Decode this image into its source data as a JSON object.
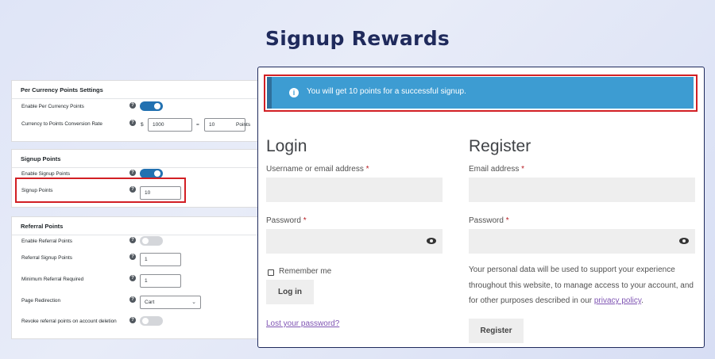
{
  "headline": "Signup Rewards",
  "admin": {
    "currency_section": {
      "title": "Per Currency Points Settings",
      "enable_label": "Enable Per Currency Points",
      "enable_state": "on",
      "conversion_label": "Currency to Points Conversion Rate",
      "currency_symbol": "$",
      "currency_value": "1000",
      "equals_sign": "=",
      "points_value": "10",
      "points_suffix": "Points"
    },
    "signup_section": {
      "title": "Signup Points",
      "enable_label": "Enable Signup Points",
      "enable_state": "on",
      "points_label": "Signup Points",
      "points_value": "10"
    },
    "referral_section": {
      "title": "Referral Points",
      "enable_label": "Enable Referral Points",
      "enable_state": "off",
      "signup_points_label": "Referral Signup Points",
      "signup_points_value": "1",
      "min_required_label": "Minimum Referral Required",
      "min_required_value": "1",
      "redirect_label": "Page Redirection",
      "redirect_value": "Cart",
      "revoke_label": "Revoke referral points on account deletion",
      "revoke_state": "off"
    },
    "help_glyph": "?"
  },
  "front": {
    "notice_icon": "i",
    "notice": "You will get 10 points for a successful signup.",
    "login": {
      "title": "Login",
      "username_label": "Username or email address",
      "password_label": "Password",
      "required_mark": "*",
      "remember_label": "Remember me",
      "login_button": "Log in",
      "lost_password": "Lost your password?"
    },
    "register": {
      "title": "Register",
      "email_label": "Email address",
      "password_label": "Password",
      "required_mark": "*",
      "privacy_text_before": "Your personal data will be used to support your experience throughout this website, to manage access to your account, and for other purposes described in our ",
      "privacy_link": "privacy policy",
      "privacy_text_after": ".",
      "register_button": "Register"
    }
  },
  "colors": {
    "accent_blue": "#2271b1",
    "notice_blue": "#3d9cd2",
    "highlight_red": "#d21f24",
    "link_purple": "#7f54b3",
    "headline_navy": "#1f2a5c"
  },
  "icons": [
    "help-icon",
    "info-icon",
    "eye-icon",
    "chevron-down-icon",
    "checkbox-icon"
  ]
}
